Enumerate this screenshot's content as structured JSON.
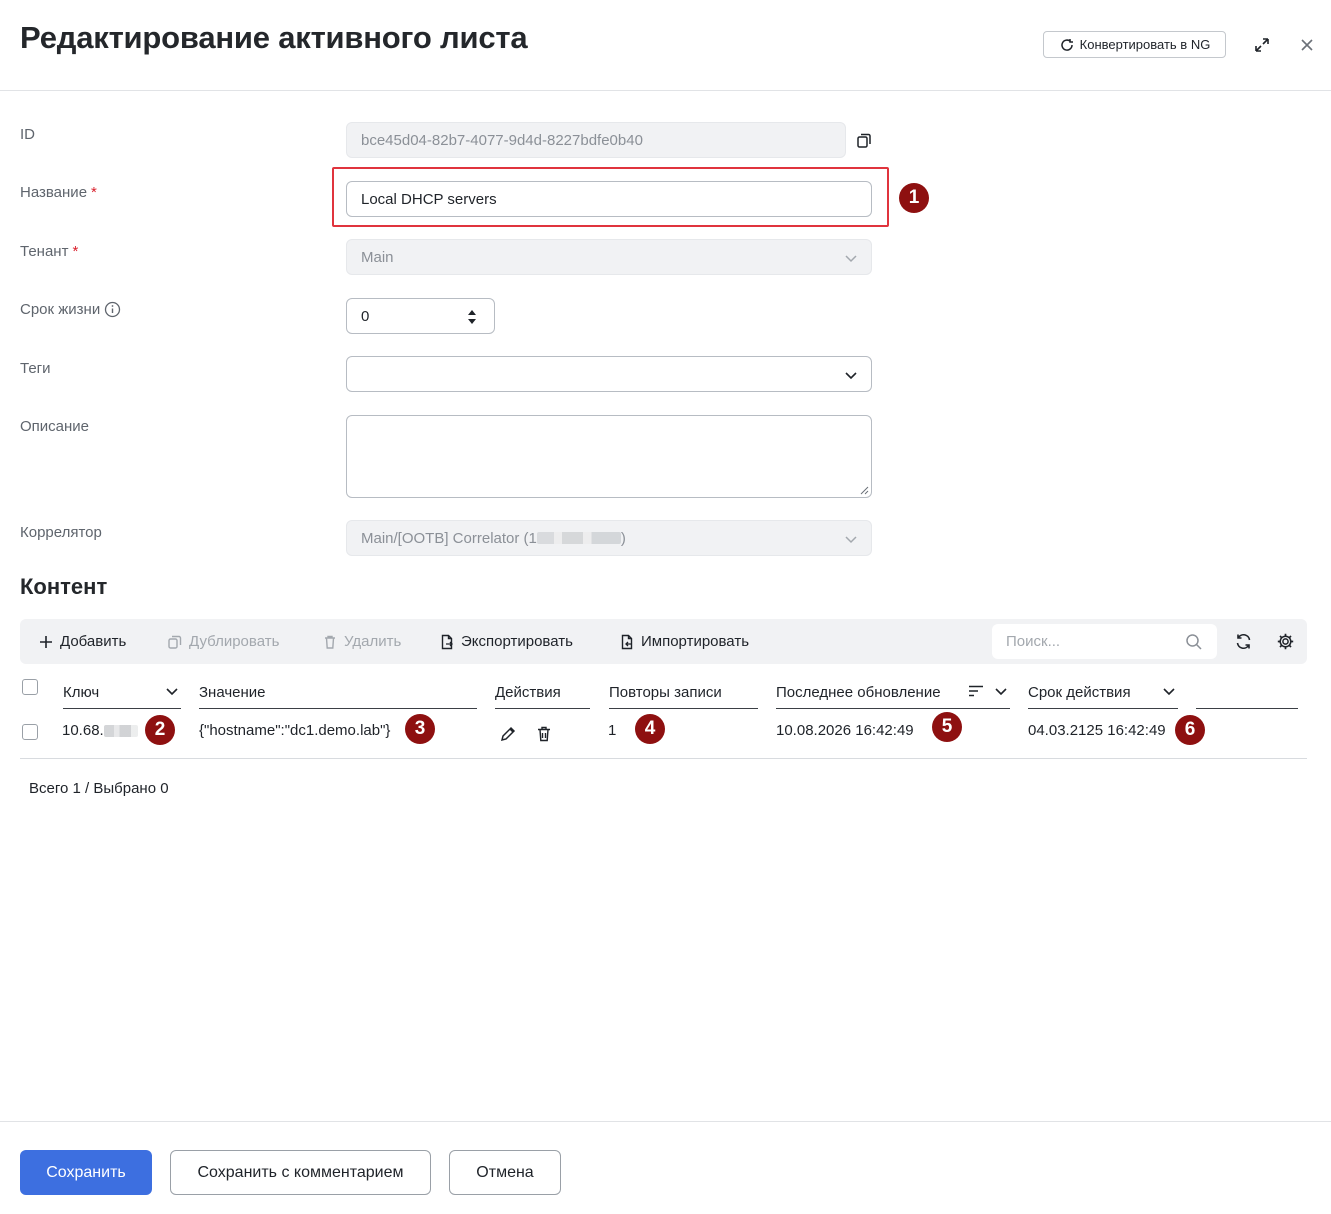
{
  "header": {
    "title": "Редактирование активного листа",
    "convert_label": "Конвертировать в NG"
  },
  "form": {
    "id_label": "ID",
    "id_value": "bce45d04-82b7-4077-9d4d-8227bdfe0b40",
    "name_label": "Название",
    "name_value": "Local DHCP servers",
    "tenant_label": "Тенант",
    "tenant_value": "Main",
    "ttl_label": "Срок жизни",
    "ttl_value": "0",
    "tags_label": "Теги",
    "tags_value": "",
    "description_label": "Описание",
    "correlator_label": "Коррелятор",
    "correlator_prefix": "Main/[OOTB] Correlator (1",
    "correlator_suffix": ")",
    "required_mark": "*"
  },
  "content": {
    "title": "Контент",
    "toolbar": {
      "add": "Добавить",
      "duplicate": "Дублировать",
      "delete": "Удалить",
      "export": "Экспортировать",
      "import": "Импортировать",
      "search_placeholder": "Поиск..."
    },
    "columns": [
      "Ключ",
      "Значение",
      "Действия",
      "Повторы записи",
      "Последнее обновление",
      "Срок действия"
    ],
    "rows": [
      {
        "key_prefix": "10.68.",
        "value": "{\"hostname\":\"dc1.demo.lab\"}",
        "repeats": "1",
        "last_update": "10.08.2026 16:42:49",
        "expires": "04.03.2125 16:42:49"
      }
    ],
    "summary": "Всего 1 / Выбрано 0"
  },
  "badges": [
    "1",
    "2",
    "3",
    "4",
    "5",
    "6"
  ],
  "footer": {
    "save": "Сохранить",
    "save_comment": "Сохранить с комментарием",
    "cancel": "Отмена"
  },
  "colors": {
    "primary": "#3d6fe0",
    "badge": "#8e1010",
    "highlight": "#e0343d"
  }
}
